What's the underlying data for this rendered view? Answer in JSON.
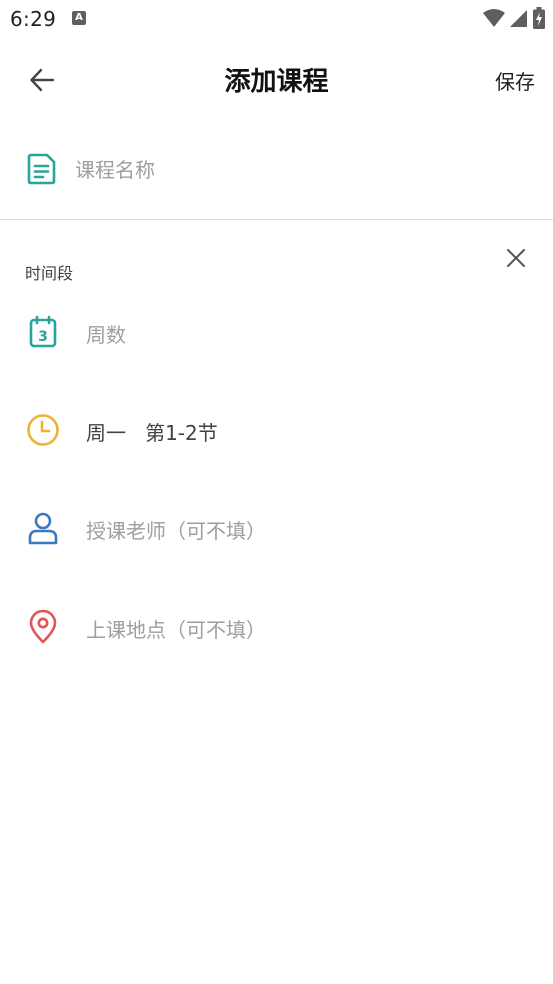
{
  "status_bar": {
    "time": "6:29",
    "notification_icon": "A"
  },
  "app_bar": {
    "title": "添加课程",
    "save_label": "保存"
  },
  "course_name": {
    "placeholder": "课程名称",
    "value": ""
  },
  "time_section": {
    "label": "时间段",
    "weeks": {
      "placeholder": "周数",
      "icon_text": "3"
    },
    "day_period": {
      "value": "周一   第1-2节"
    },
    "teacher": {
      "placeholder": "授课老师（可不填）"
    },
    "location": {
      "placeholder": "上课地点（可不填）"
    }
  },
  "colors": {
    "teal": "#26a69a",
    "amber": "#f0b030",
    "blue": "#3b78c0",
    "red": "#e05555",
    "placeholder": "#9e9e9e",
    "divider": "#dcdcdc"
  }
}
